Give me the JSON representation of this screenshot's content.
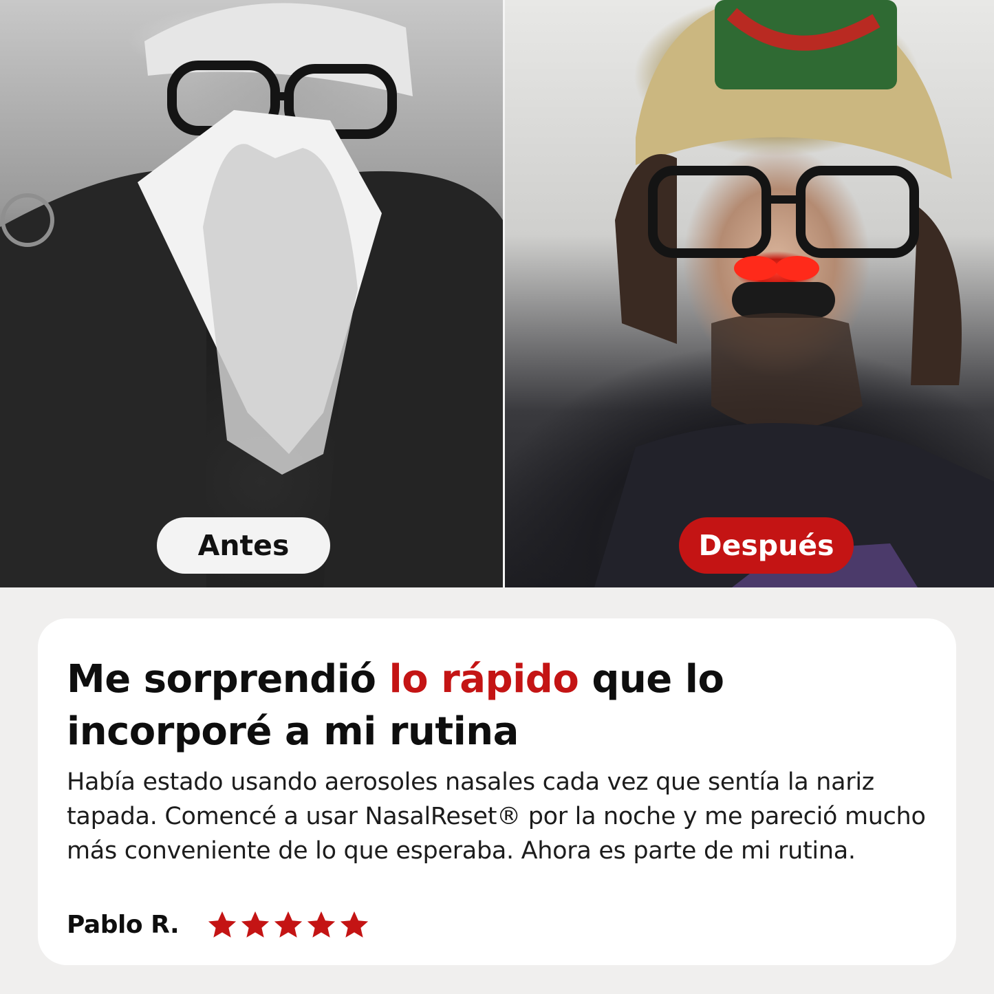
{
  "photos": {
    "before_label": "Antes",
    "after_label": "Después"
  },
  "review": {
    "headline_part1": "Me sorprendió ",
    "headline_highlight": "lo rápido",
    "headline_part2": " que lo incorporé a mi rutina",
    "body": "Había estado usando aerosoles nasales cada vez que sentía la nariz tapada. Comencé a usar NasalReset® por la noche y me pareció mucho más conveniente de lo que esperaba. Ahora es parte de mi rutina.",
    "author": "Pablo R.",
    "rating": 5
  },
  "colors": {
    "accent": "#c41414",
    "star": "#c41414",
    "text": "#0e0e0e",
    "card": "#ffffff",
    "page": "#f0efee"
  },
  "icons": [
    "star-icon"
  ]
}
